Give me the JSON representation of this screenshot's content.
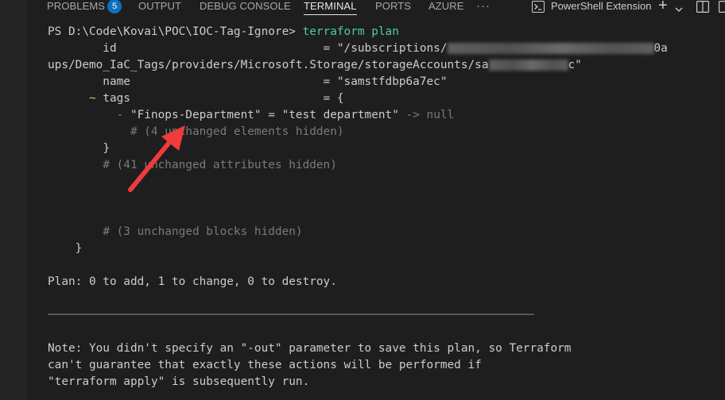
{
  "tabs": {
    "problems": "PROBLEMS",
    "problems_count": "5",
    "output": "OUTPUT",
    "debug_console": "DEBUG CONSOLE",
    "terminal": "TERMINAL",
    "ports": "PORTS",
    "azure": "AZURE",
    "more": "···"
  },
  "toolbar": {
    "shell_name": "PowerShell Extension",
    "add": "+",
    "chevron": "⌄"
  },
  "terminal": {
    "prompt": "PS D:\\Code\\Kovai\\POC\\IOC-Tag-Ignore>",
    "command": "terraform plan",
    "id_line_key": "        id                              = \"/subscriptions/",
    "id_line_tail": "0a",
    "path_line_head": "ups/Demo_IaC_Tags/providers/Microsoft.Storage/storageAccounts/sa",
    "path_line_tail": "c\"",
    "name_line": "        name                            = \"samstfdbp6a7ec\"",
    "tags_tilde": "~",
    "tags_line": " tags                            = {",
    "tag_minus": "-",
    "tag_line": " \"Finops-Department\" = \"test department\" ",
    "tag_arrow_null": "-> null",
    "hidden_elements": "# (4 unchanged elements hidden)",
    "close_tags": "}",
    "hidden_attributes": "# (41 unchanged attributes hidden)",
    "hidden_blocks": "# (3 unchanged blocks hidden)",
    "close_resource": "}",
    "plan_summary": "Plan: 0 to add, 1 to change, 0 to destroy.",
    "separator": "─────────────────────────────────────────────────────────────────────",
    "note_1": "Note: You didn't specify an \"-out\" parameter to save this plan, so Terraform",
    "note_2": "can't guarantee that exactly these actions will be performed if",
    "note_3": "\"terraform apply\" is subsequently run."
  },
  "colors": {
    "background": "#1e1e1e",
    "command": "#4ec9b0",
    "update_marker": "#e5c07b",
    "delete_marker": "#f14c4c",
    "annotation_arrow": "#ef3b3b",
    "badge": "#0e70c0"
  }
}
